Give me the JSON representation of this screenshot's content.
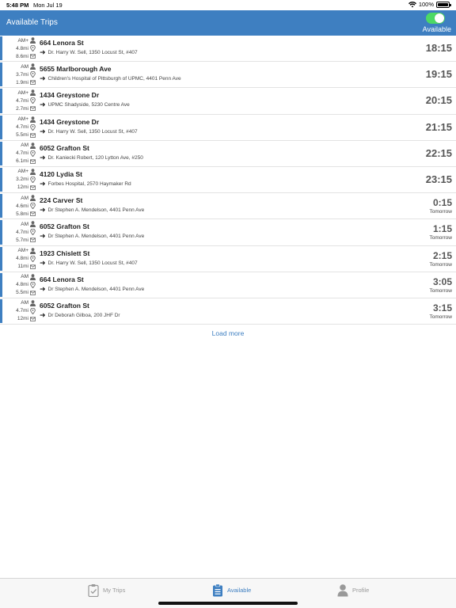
{
  "status_bar": {
    "time": "5:48 PM",
    "date": "Mon Jul 19",
    "battery": "100%"
  },
  "header": {
    "title": "Available Trips",
    "toggle_label": "Available",
    "toggle_on": true
  },
  "trips": [
    {
      "tag": "AM+",
      "dist1": "4.8mi",
      "dist2": "8.6mi",
      "address": "664 Lenora St",
      "destination": "Dr. Harry W. Sell, 1350 Locust St, #407",
      "time": "18:15",
      "day": ""
    },
    {
      "tag": "AM",
      "dist1": "3.7mi",
      "dist2": "1.9mi",
      "address": "5655 Marlborough Ave",
      "destination": "Children's Hospital of Pittsburgh of UPMC, 4401 Penn Ave",
      "time": "19:15",
      "day": ""
    },
    {
      "tag": "AM+",
      "dist1": "4.7mi",
      "dist2": "2.7mi",
      "address": "1434 Greystone Dr",
      "destination": "UPMC Shadyside, 5230 Centre Ave",
      "time": "20:15",
      "day": ""
    },
    {
      "tag": "AM+",
      "dist1": "4.7mi",
      "dist2": "5.5mi",
      "address": "1434 Greystone Dr",
      "destination": "Dr. Harry W. Sell, 1350 Locust St, #407",
      "time": "21:15",
      "day": ""
    },
    {
      "tag": "AM",
      "dist1": "4.7mi",
      "dist2": "6.1mi",
      "address": "6052 Grafton St",
      "destination": "Dr. Kaniecki Robert, 120 Lytton Ave, #250",
      "time": "22:15",
      "day": ""
    },
    {
      "tag": "AM+",
      "dist1": "3.2mi",
      "dist2": "12mi",
      "address": "4120 Lydia St",
      "destination": "Forbes Hospital, 2570 Haymaker Rd",
      "time": "23:15",
      "day": ""
    },
    {
      "tag": "AM",
      "dist1": "4.6mi",
      "dist2": "5.8mi",
      "address": "224 Carver St",
      "destination": "Dr Stephen A. Mendelson, 4401 Penn Ave",
      "time": "0:15",
      "day": "Tomorrow"
    },
    {
      "tag": "AM",
      "dist1": "4.7mi",
      "dist2": "5.7mi",
      "address": "6052 Grafton St",
      "destination": "Dr Stephen A. Mendelson, 4401 Penn Ave",
      "time": "1:15",
      "day": "Tomorrow"
    },
    {
      "tag": "AM+",
      "dist1": "4.8mi",
      "dist2": "11mi",
      "address": "1923 Chislett St",
      "destination": "Dr. Harry W. Sell, 1350 Locust St, #407",
      "time": "2:15",
      "day": "Tomorrow"
    },
    {
      "tag": "AM",
      "dist1": "4.8mi",
      "dist2": "5.5mi",
      "address": "664 Lenora St",
      "destination": "Dr Stephen A. Mendelson, 4401 Penn Ave",
      "time": "3:05",
      "day": "Tomorrow"
    },
    {
      "tag": "AM",
      "dist1": "4.7mi",
      "dist2": "12mi",
      "address": "6052 Grafton St",
      "destination": "Dr Deborah Gilboa, 200 JHF Dr",
      "time": "3:15",
      "day": "Tomorrow"
    }
  ],
  "load_more": "Load more",
  "tabs": [
    {
      "label": "My Trips",
      "icon": "clipboard-check-icon",
      "active": false
    },
    {
      "label": "Available",
      "icon": "clipboard-list-icon",
      "active": true
    },
    {
      "label": "Profile",
      "icon": "person-icon",
      "active": false
    }
  ],
  "colors": {
    "accent": "#3e7fc1",
    "toggle_on": "#4cd964"
  }
}
